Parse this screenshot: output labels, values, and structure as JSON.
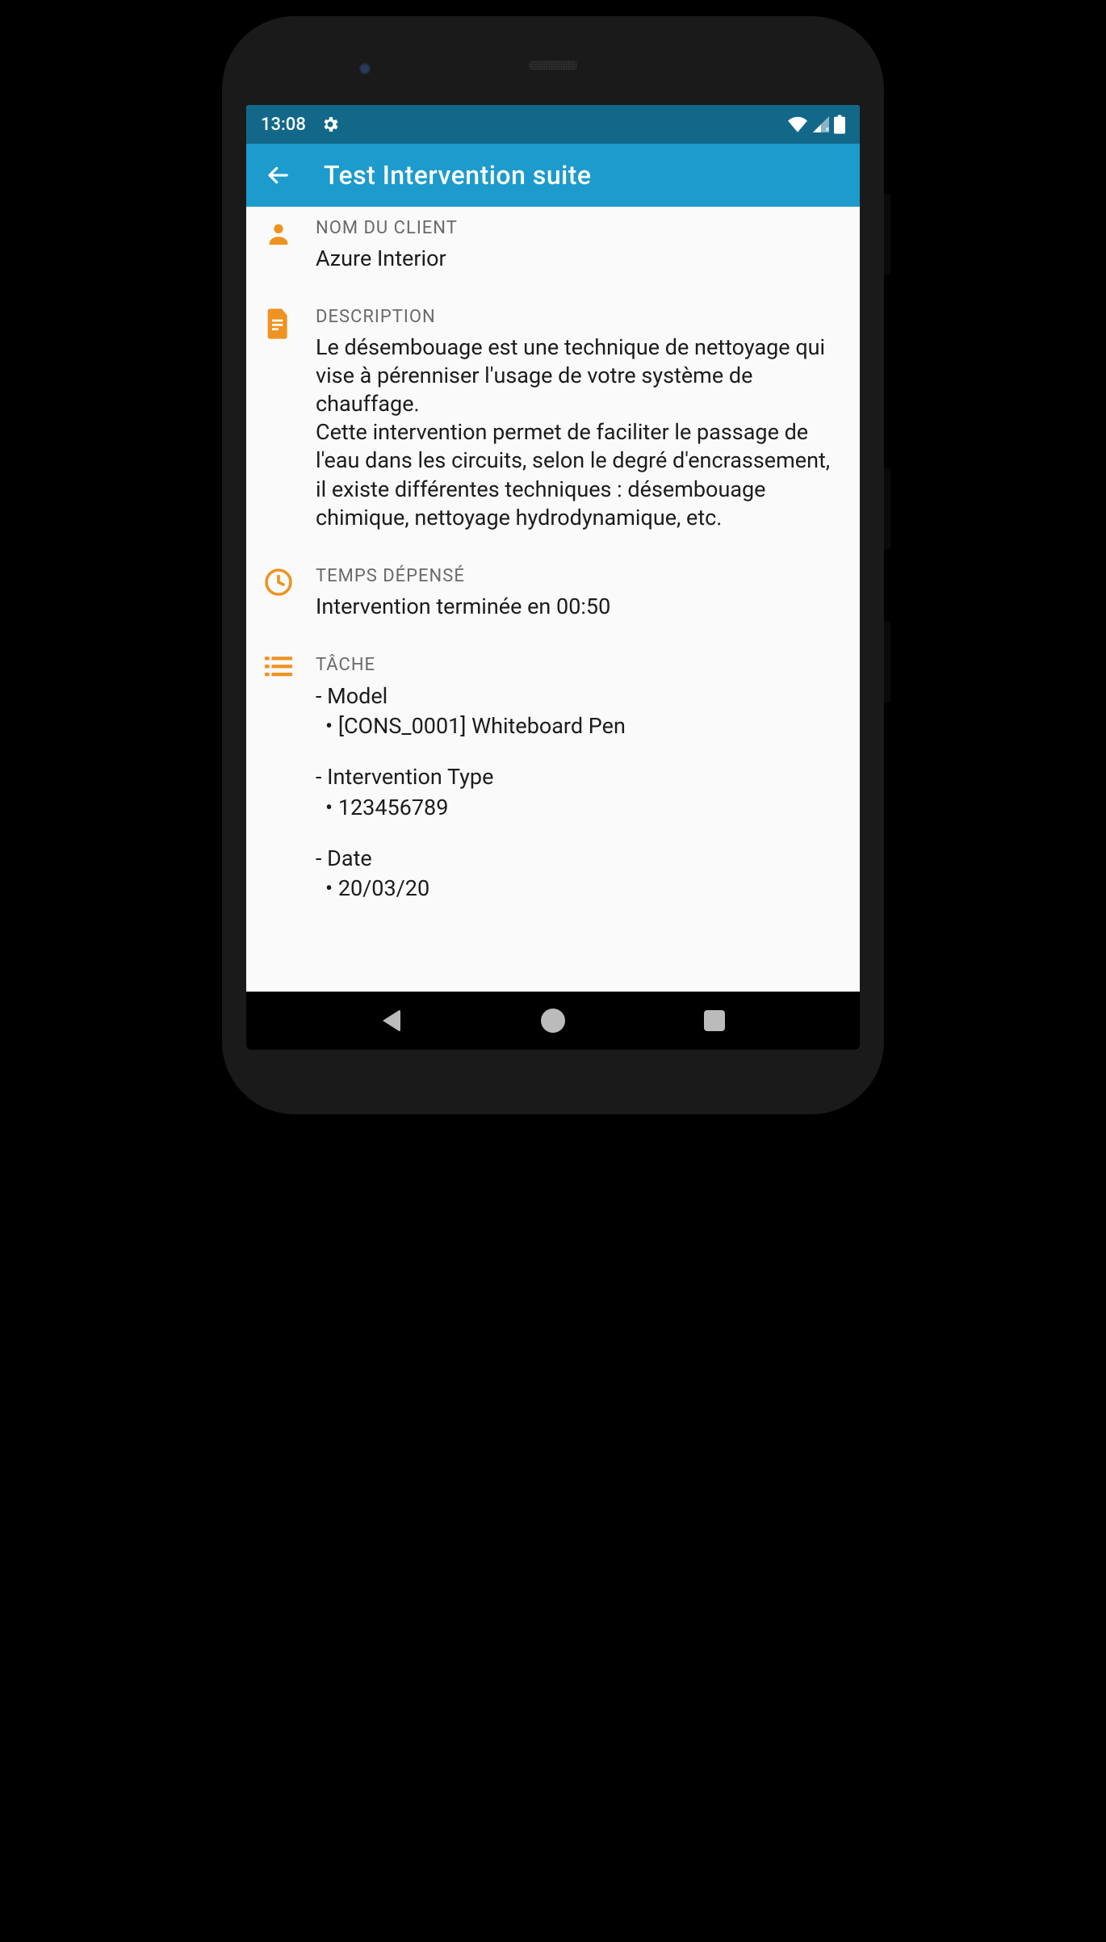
{
  "status": {
    "time": "13:08"
  },
  "appbar": {
    "title": "Test Intervention suite"
  },
  "client": {
    "label": "NOM DU CLIENT",
    "value": "Azure Interior"
  },
  "description": {
    "label": "DESCRIPTION",
    "value": "Le désembouage est une technique de nettoyage qui vise à pérenniser l'usage de votre système de chauffage.\nCette intervention permet de faciliter le passage de l'eau dans les circuits, selon le degré d'encrassement, il existe différentes techniques : désembouage chimique, nettoyage hydrodynamique, etc."
  },
  "time_spent": {
    "label": "TEMPS DÉPENSÉ",
    "value": "Intervention terminée en 00:50"
  },
  "task": {
    "label": "TÂCHE",
    "items": [
      {
        "name": "Model",
        "value": "[CONS_0001] Whiteboard Pen"
      },
      {
        "name": "Intervention Type",
        "value": "123456789"
      },
      {
        "name": "Date",
        "value": "20/03/20"
      }
    ]
  },
  "colors": {
    "accent": "#ee9322",
    "appbar": "#1c9bcc",
    "statusbar": "#13688a"
  }
}
